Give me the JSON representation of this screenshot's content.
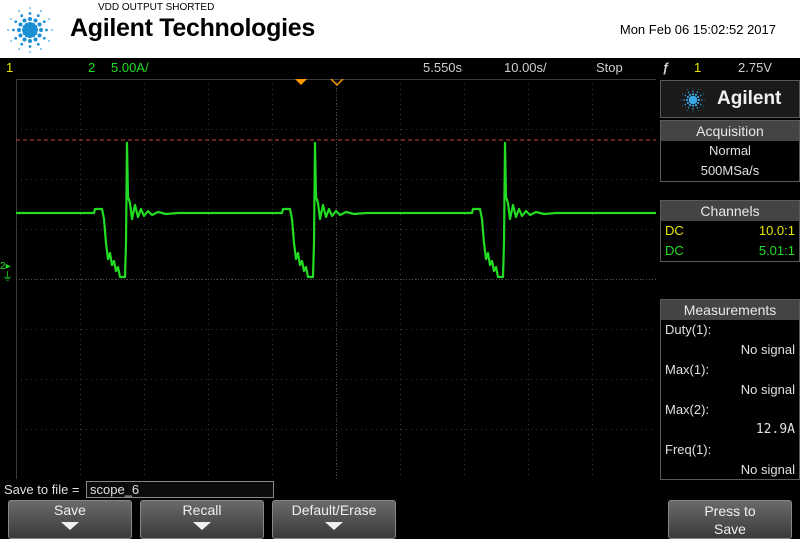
{
  "header": {
    "note": "VDD OUTPUT SHORTED",
    "brand": "Agilent Technologies",
    "datetime": "Mon Feb 06 15:02:52 2017"
  },
  "statusbar": {
    "ch1_label": "1",
    "ch2_label": "2",
    "ch2_scale": "5.00A/",
    "time_delay": "5.550s",
    "time_scale": "10.00s/",
    "run_state": "Stop",
    "trigger_icon": "trigger-edge-icon",
    "trigger_source": "1",
    "trigger_level": "2.75V"
  },
  "display": {
    "ground_marker": "2",
    "colors": {
      "ch1": "#e8e800",
      "ch2": "#22dd22",
      "trigger_line": "#d04040",
      "marker": "#ff9900"
    }
  },
  "panel": {
    "brand": "Agilent",
    "acquisition": {
      "title": "Acquisition",
      "mode": "Normal",
      "rate": "500MSa/s"
    },
    "channels": {
      "title": "Channels",
      "rows": [
        {
          "coupling": "DC",
          "probe": "10.0:1",
          "color": "#e8e800"
        },
        {
          "coupling": "DC",
          "probe": "5.01:1",
          "color": "#22dd22"
        }
      ]
    },
    "measurements": {
      "title": "Measurements",
      "items": [
        {
          "name": "Duty(1):",
          "value": "No signal"
        },
        {
          "name": "Max(1):",
          "value": "No signal"
        },
        {
          "name": "Max(2):",
          "value": "12.9A"
        },
        {
          "name": "Freq(1):",
          "value": "No signal"
        }
      ]
    }
  },
  "save": {
    "label": "Save to file =",
    "filename": "scope_6"
  },
  "softkeys": {
    "save": "Save",
    "recall": "Recall",
    "default_erase": "Default/Erase",
    "press_line1": "Press to",
    "press_line2": "Save"
  }
}
